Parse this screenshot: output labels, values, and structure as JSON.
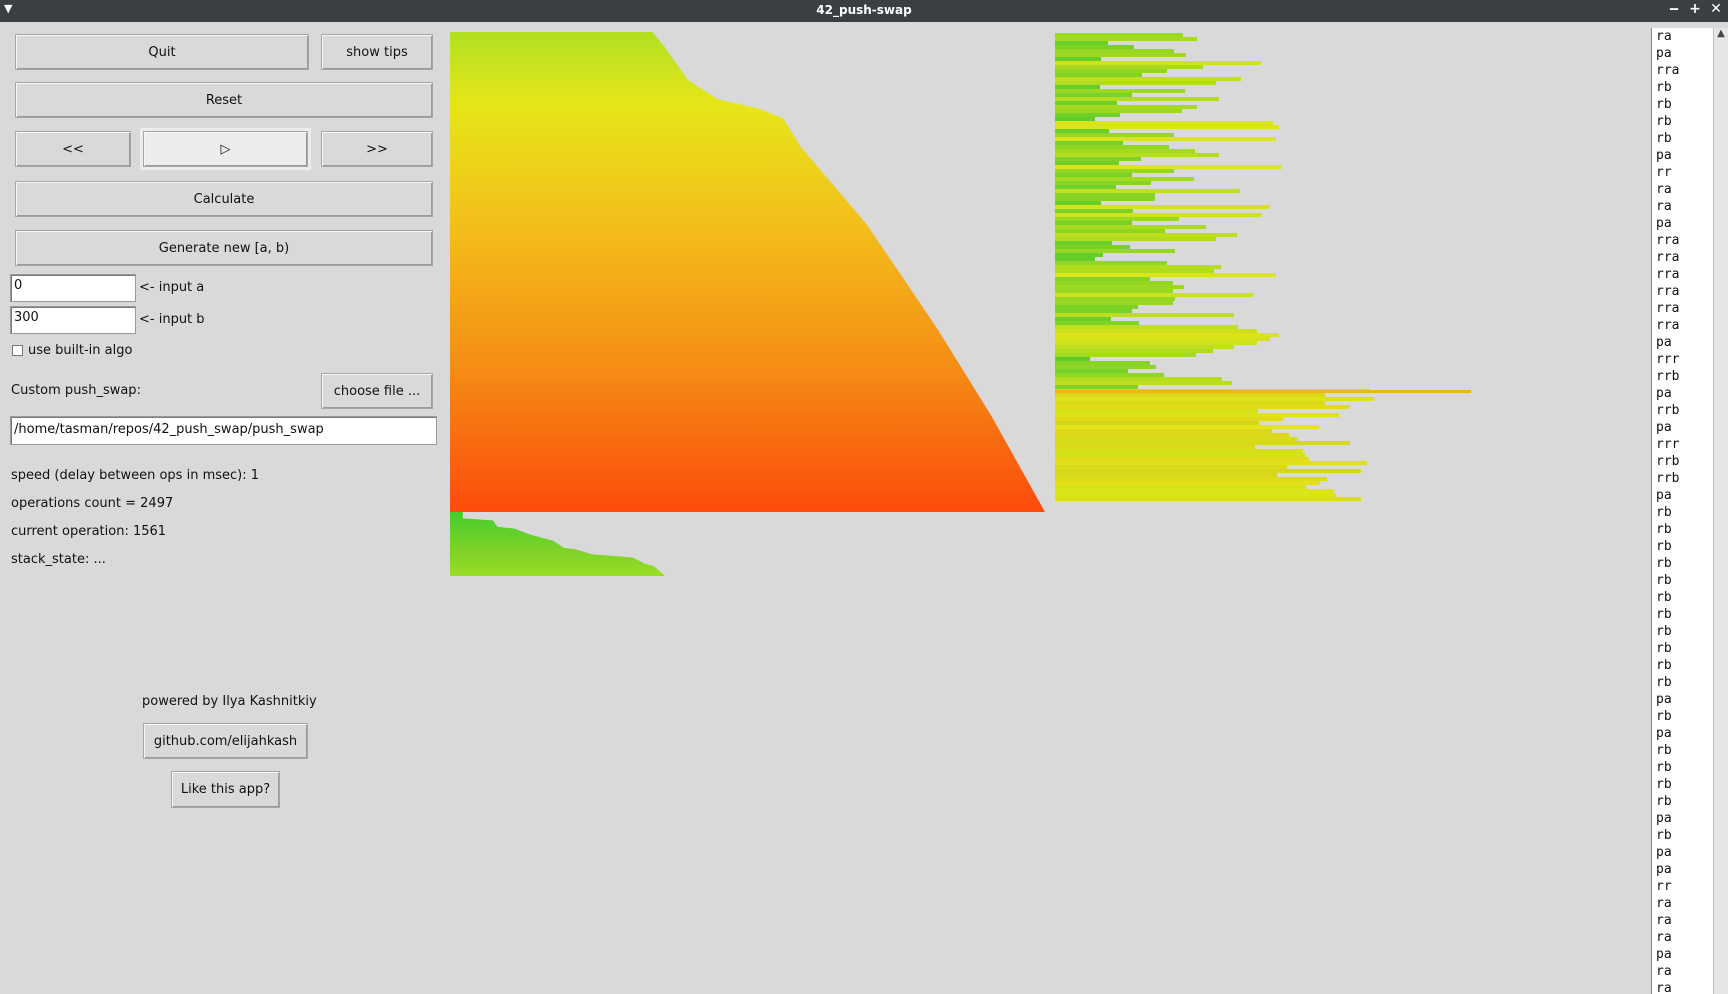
{
  "window": {
    "title": "42_push-swap",
    "controls": [
      "‒",
      "+",
      "✕"
    ]
  },
  "buttons": {
    "quit": "Quit",
    "show_tips": "show tips",
    "reset": "Reset",
    "prev": "<<",
    "play": "▷",
    "next": ">>",
    "calculate": "Calculate",
    "generate": "Generate new [a, b)",
    "choose_file": "choose file ...",
    "github": "github.com/elijahkash",
    "like": "Like this app?"
  },
  "inputs": {
    "a_value": "0",
    "a_label": "<- input a",
    "b_value": "300",
    "b_label": "<- input b",
    "builtin_algo_label": "use built-in algo",
    "builtin_algo_checked": false,
    "custom_label": "Custom push_swap:",
    "path_value": "/home/tasman/repos/42_push_swap/push_swap"
  },
  "status": {
    "speed": "speed (delay between ops in msec): 1",
    "ops_count": "operations count = 2497",
    "current_op": "current operation: 1561",
    "stack_state": "stack_state: ..."
  },
  "footer": {
    "powered_by": "powered by Ilya Kashnitkiy"
  },
  "operations": [
    "ra",
    "pa",
    "rra",
    "rb",
    "rb",
    "rb",
    "rb",
    "pa",
    "rr",
    "ra",
    "ra",
    "pa",
    "rra",
    "rra",
    "rra",
    "rra",
    "rra",
    "rra",
    "pa",
    "rrr",
    "rrb",
    "pa",
    "rrb",
    "pa",
    "rrr",
    "rrb",
    "rrb",
    "pa",
    "rb",
    "rb",
    "rb",
    "rb",
    "rb",
    "rb",
    "rb",
    "rb",
    "rb",
    "rb",
    "rb",
    "pa",
    "rb",
    "pa",
    "rb",
    "rb",
    "rb",
    "rb",
    "pa",
    "rb",
    "pa",
    "pa",
    "rr",
    "ra",
    "ra",
    "ra",
    "pa",
    "ra",
    "ra"
  ],
  "colors": {
    "stackA_top": "#b0e021",
    "stackA_bottom": "#fc4a0a",
    "stackB_green": "#45cc2e",
    "stackB_yellow": "#e6e61a"
  }
}
